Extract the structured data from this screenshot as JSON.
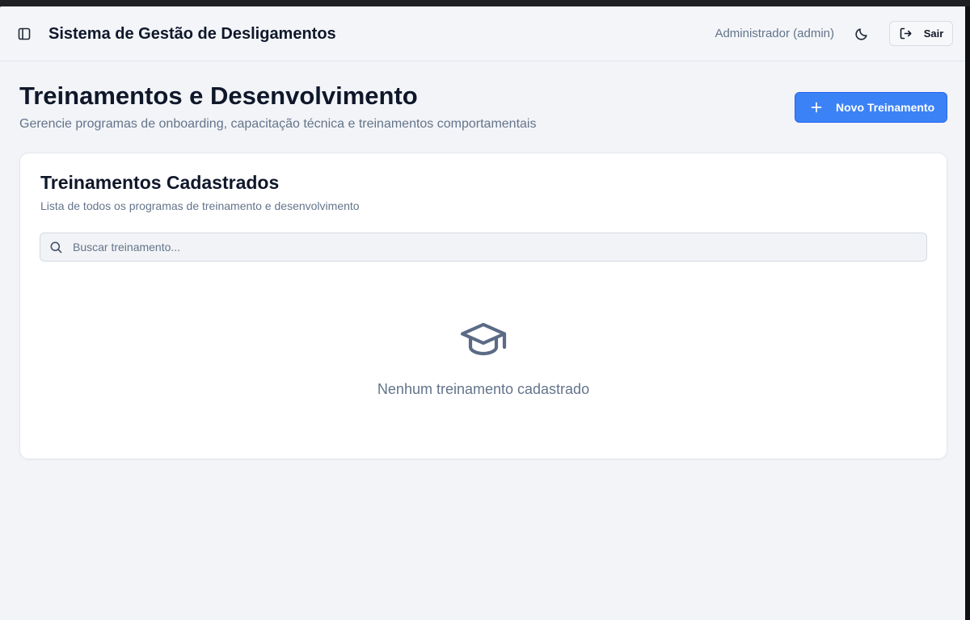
{
  "header": {
    "app_title": "Sistema de Gestão de Desligamentos",
    "user_label": "Administrador (admin)",
    "logout_label": "Sair"
  },
  "page": {
    "title": "Treinamentos e Desenvolvimento",
    "subtitle": "Gerencie programas de onboarding, capacitação técnica e treinamentos comportamentais",
    "new_button_label": "Novo Treinamento"
  },
  "card": {
    "title": "Treinamentos Cadastrados",
    "subtitle": "Lista de todos os programas de treinamento e desenvolvimento",
    "search": {
      "placeholder": "Buscar treinamento...",
      "value": ""
    },
    "empty_state": {
      "icon": "graduation-cap-icon",
      "message": "Nenhum treinamento cadastrado"
    }
  },
  "colors": {
    "accent": "#3b82f6",
    "text_primary": "#0f172a",
    "text_muted": "#64748b",
    "background": "#f2f4f7"
  },
  "icons": {
    "sidebar_toggle": "sidebar-panel-icon",
    "theme_toggle": "moon-icon",
    "logout": "logout-icon",
    "new_training": "plus-icon",
    "search": "search-icon",
    "empty": "graduation-cap-icon"
  }
}
